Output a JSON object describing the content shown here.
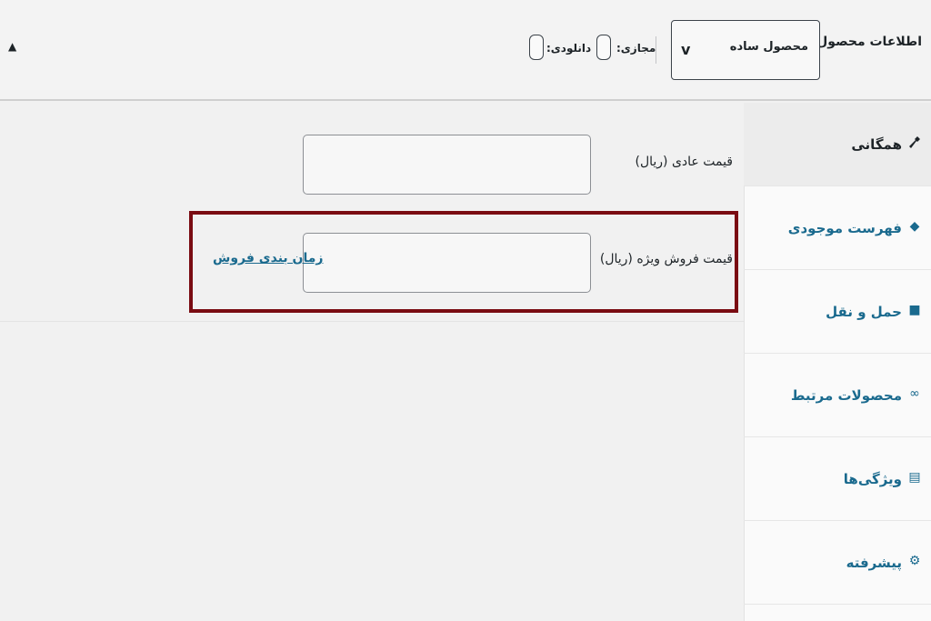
{
  "header": {
    "title": "اطلاعات محصول —",
    "product_type": "محصول ساده",
    "virtual_label": "مجازی:",
    "downloadable_label": "دانلودی:",
    "collapse_glyph": "▲",
    "select_chevron": "v"
  },
  "tabs": [
    {
      "label": "همگانی",
      "icon": "wrench-icon",
      "glyph": "🔧",
      "active": true
    },
    {
      "label": "فهرست موجودی",
      "icon": "diamond-icon",
      "glyph": "◆",
      "active": false
    },
    {
      "label": "حمل و نقل",
      "icon": "truck-icon",
      "glyph": "■",
      "active": false
    },
    {
      "label": "محصولات مرتبط",
      "icon": "link-icon",
      "glyph": "∞",
      "active": false
    },
    {
      "label": "ویژگی‌ها",
      "icon": "list-icon",
      "glyph": "▤",
      "active": false
    },
    {
      "label": "پیشرفته",
      "icon": "gear-icon",
      "glyph": "⚙",
      "active": false
    }
  ],
  "general": {
    "regular_price_label": "قیمت عادی (ریال)",
    "regular_price_value": "",
    "sale_price_label": "قیمت فروش ویژه (ریال)",
    "sale_price_value": "",
    "schedule_link": "زمان بندی فروش"
  },
  "colors": {
    "highlight_border": "#7a0c12",
    "link": "#1a6a8e"
  }
}
